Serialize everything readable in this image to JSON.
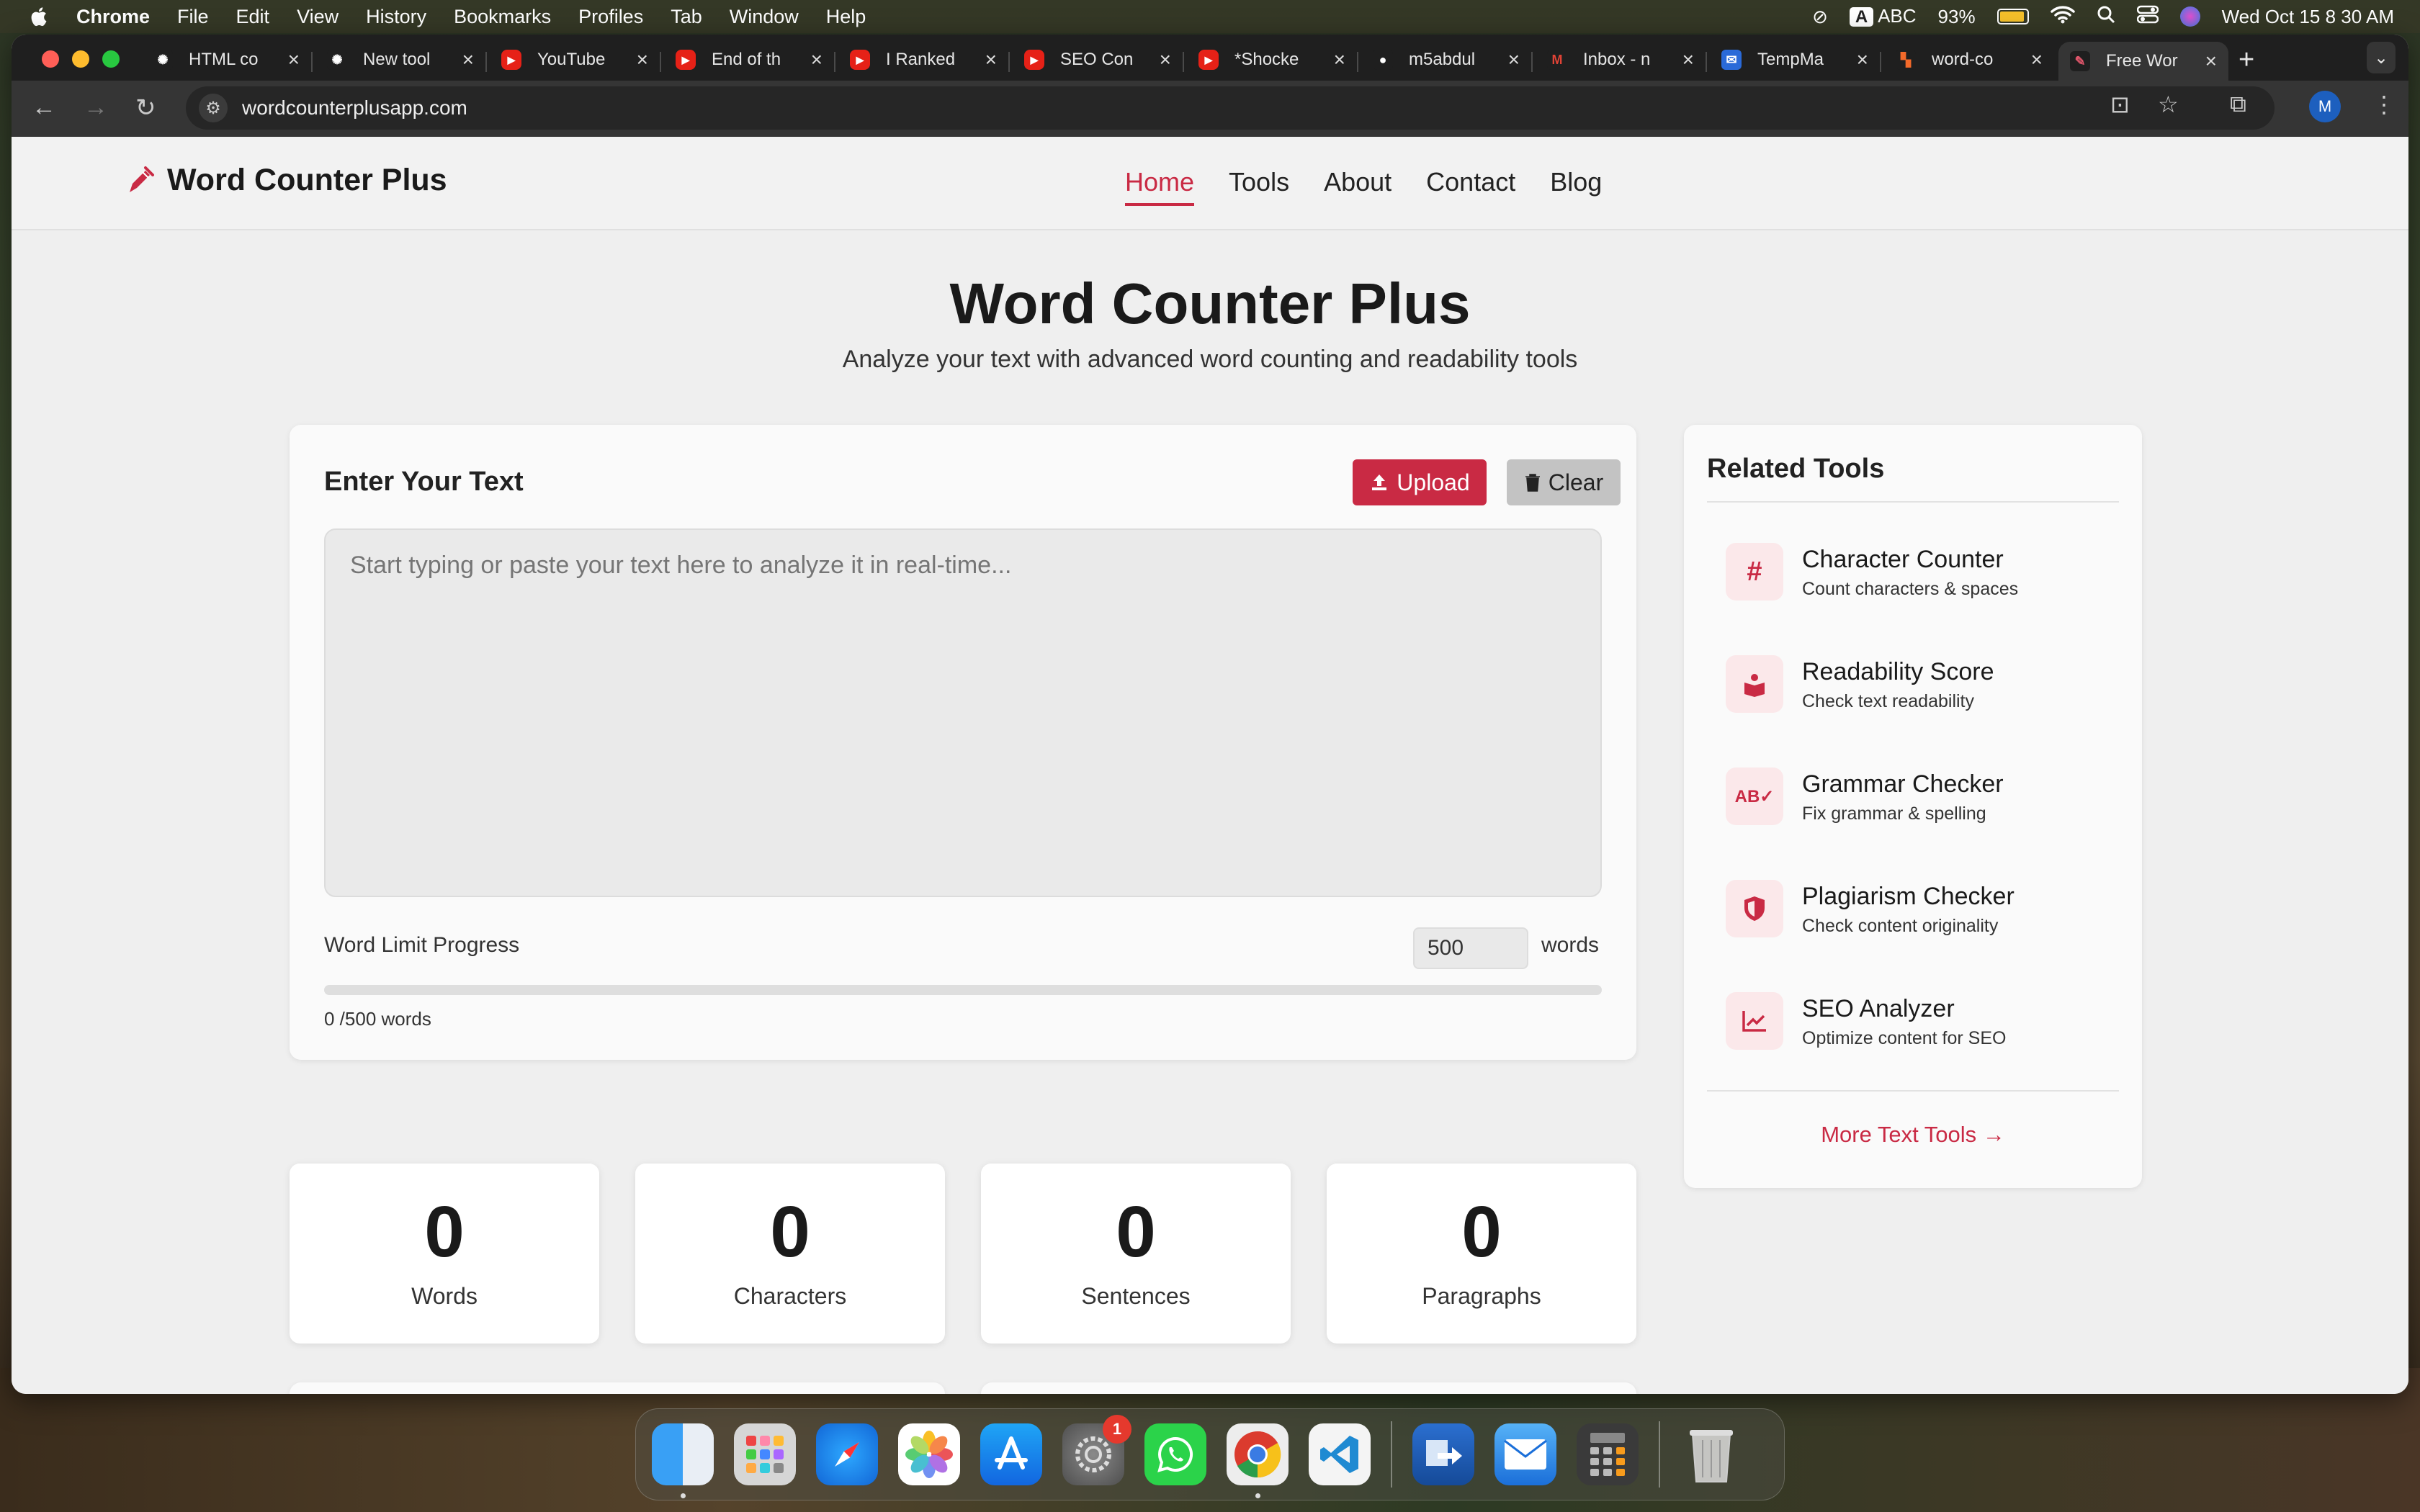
{
  "menubar": {
    "app": "Chrome",
    "items": [
      "File",
      "Edit",
      "View",
      "History",
      "Bookmarks",
      "Profiles",
      "Tab",
      "Window",
      "Help"
    ],
    "input_source": "A",
    "input_label": "ABC",
    "battery": "93%",
    "battery_level": 0.93,
    "datetime": "Wed Oct 15  8 30 AM"
  },
  "tabs": [
    {
      "title": "HTML co",
      "icon": "openai-icon",
      "color": "#1f1f1f"
    },
    {
      "title": "New tool",
      "icon": "openai-icon",
      "color": "#1f1f1f"
    },
    {
      "title": "YouTube",
      "icon": "youtube-icon",
      "color": "#e62117"
    },
    {
      "title": "End of th",
      "icon": "youtube-icon",
      "color": "#e62117"
    },
    {
      "title": "I Ranked",
      "icon": "youtube-icon",
      "color": "#e62117"
    },
    {
      "title": "SEO Con",
      "icon": "youtube-icon",
      "color": "#e62117"
    },
    {
      "title": "*Shocke",
      "icon": "youtube-icon",
      "color": "#e62117"
    },
    {
      "title": "m5abdul",
      "icon": "github-icon",
      "color": "#1f1f1f"
    },
    {
      "title": "Inbox - n",
      "icon": "gmail-icon",
      "color": "#1f1f1f"
    },
    {
      "title": "TempMa",
      "icon": "tempmail-icon",
      "color": "#2a6ad8"
    },
    {
      "title": "word-co",
      "icon": "ahrefs-icon",
      "color": "#1f1f1f"
    },
    {
      "title": "Free Wor",
      "icon": "pen-icon",
      "color": "#1f1f1f"
    }
  ],
  "address": "wordcounterplusapp.com",
  "profile_initial": "M",
  "site": {
    "brand": "Word Counter Plus",
    "nav": [
      "Home",
      "Tools",
      "About",
      "Contact",
      "Blog"
    ],
    "heading": "Word Counter Plus",
    "subheading": "Analyze your text with advanced word counting and readability tools",
    "editor": {
      "title": "Enter Your Text",
      "upload": "Upload",
      "clear": "Clear",
      "placeholder": "Start typing or paste your text here to analyze it in real-time...",
      "limit_label": "Word Limit Progress",
      "limit_value": "500",
      "limit_unit": "words",
      "progress_text": "0 /500 words",
      "progress_fraction": 0
    },
    "stats": [
      {
        "value": "0",
        "label": "Words"
      },
      {
        "value": "0",
        "label": "Characters"
      },
      {
        "value": "0",
        "label": "Sentences"
      },
      {
        "value": "0",
        "label": "Paragraphs"
      }
    ],
    "related": {
      "title": "Related Tools",
      "tools": [
        {
          "name": "Character Counter",
          "desc": "Count characters & spaces",
          "icon": "hash-icon"
        },
        {
          "name": "Readability Score",
          "desc": "Check text readability",
          "icon": "book-icon"
        },
        {
          "name": "Grammar Checker",
          "desc": "Fix grammar & spelling",
          "icon": "spellcheck-icon"
        },
        {
          "name": "Plagiarism Checker",
          "desc": "Check content originality",
          "icon": "shield-icon"
        },
        {
          "name": "SEO Analyzer",
          "desc": "Optimize content for SEO",
          "icon": "chart-line-icon"
        }
      ],
      "more": "More Text Tools →"
    },
    "accent": "#c92a44"
  },
  "dock": {
    "apps": [
      "finder",
      "launchpad",
      "safari",
      "photos",
      "app-store",
      "system-settings",
      "whatsapp",
      "chrome",
      "vscode",
      "migration",
      "mail",
      "calculator",
      "trash"
    ],
    "settings_badge": "1"
  }
}
